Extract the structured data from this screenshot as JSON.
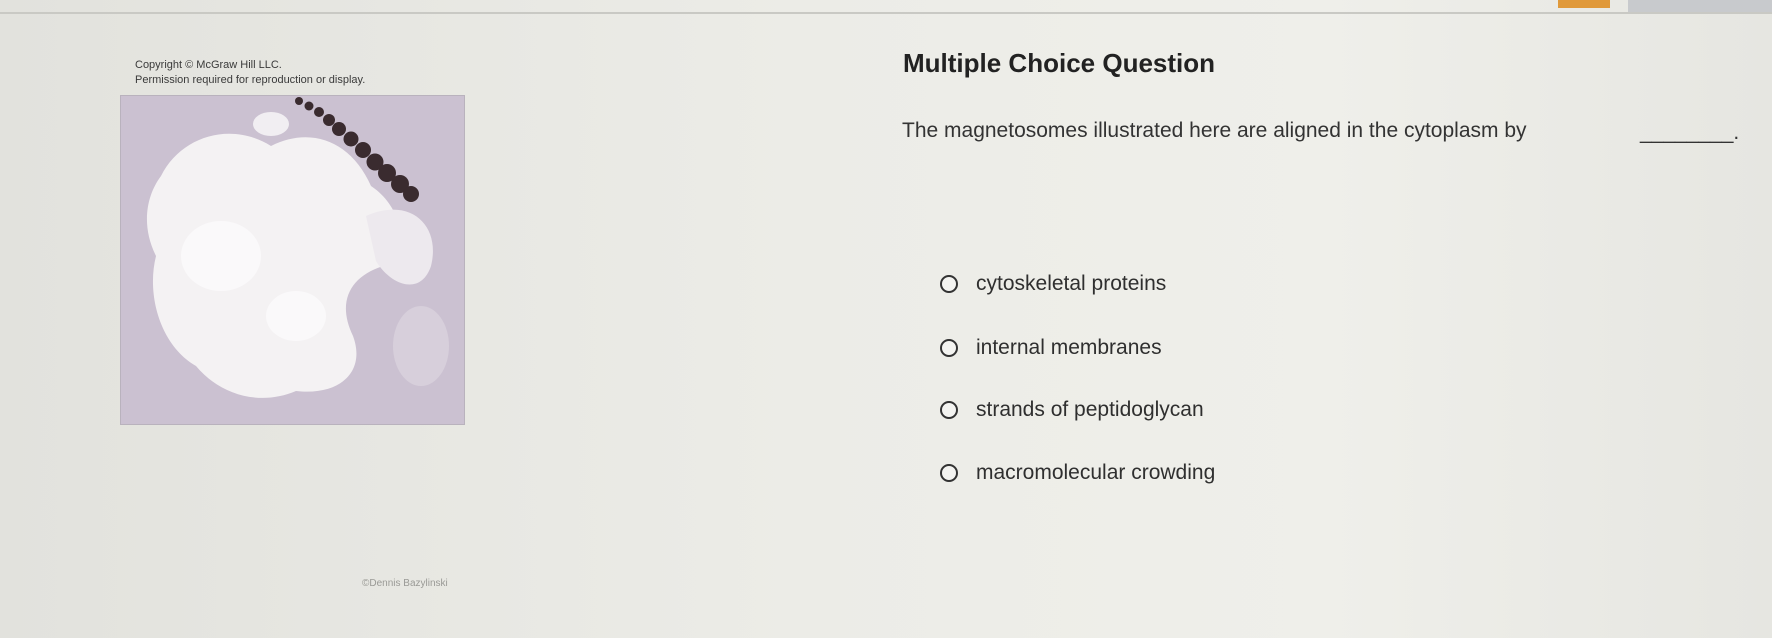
{
  "copyright": {
    "line1": "Copyright © McGraw Hill LLC.",
    "line2": "Permission required for reproduction or display."
  },
  "figure": {
    "credit": "©Dennis Bazylinski"
  },
  "question": {
    "title": "Multiple Choice Question",
    "stem": "The magnetosomes illustrated here are aligned in the cytoplasm by",
    "blank": "________."
  },
  "options": [
    {
      "label": "cytoskeletal proteins",
      "selected": false
    },
    {
      "label": "internal membranes",
      "selected": false
    },
    {
      "label": "strands of peptidoglycan",
      "selected": false
    },
    {
      "label": "macromolecular crowding",
      "selected": false
    }
  ]
}
